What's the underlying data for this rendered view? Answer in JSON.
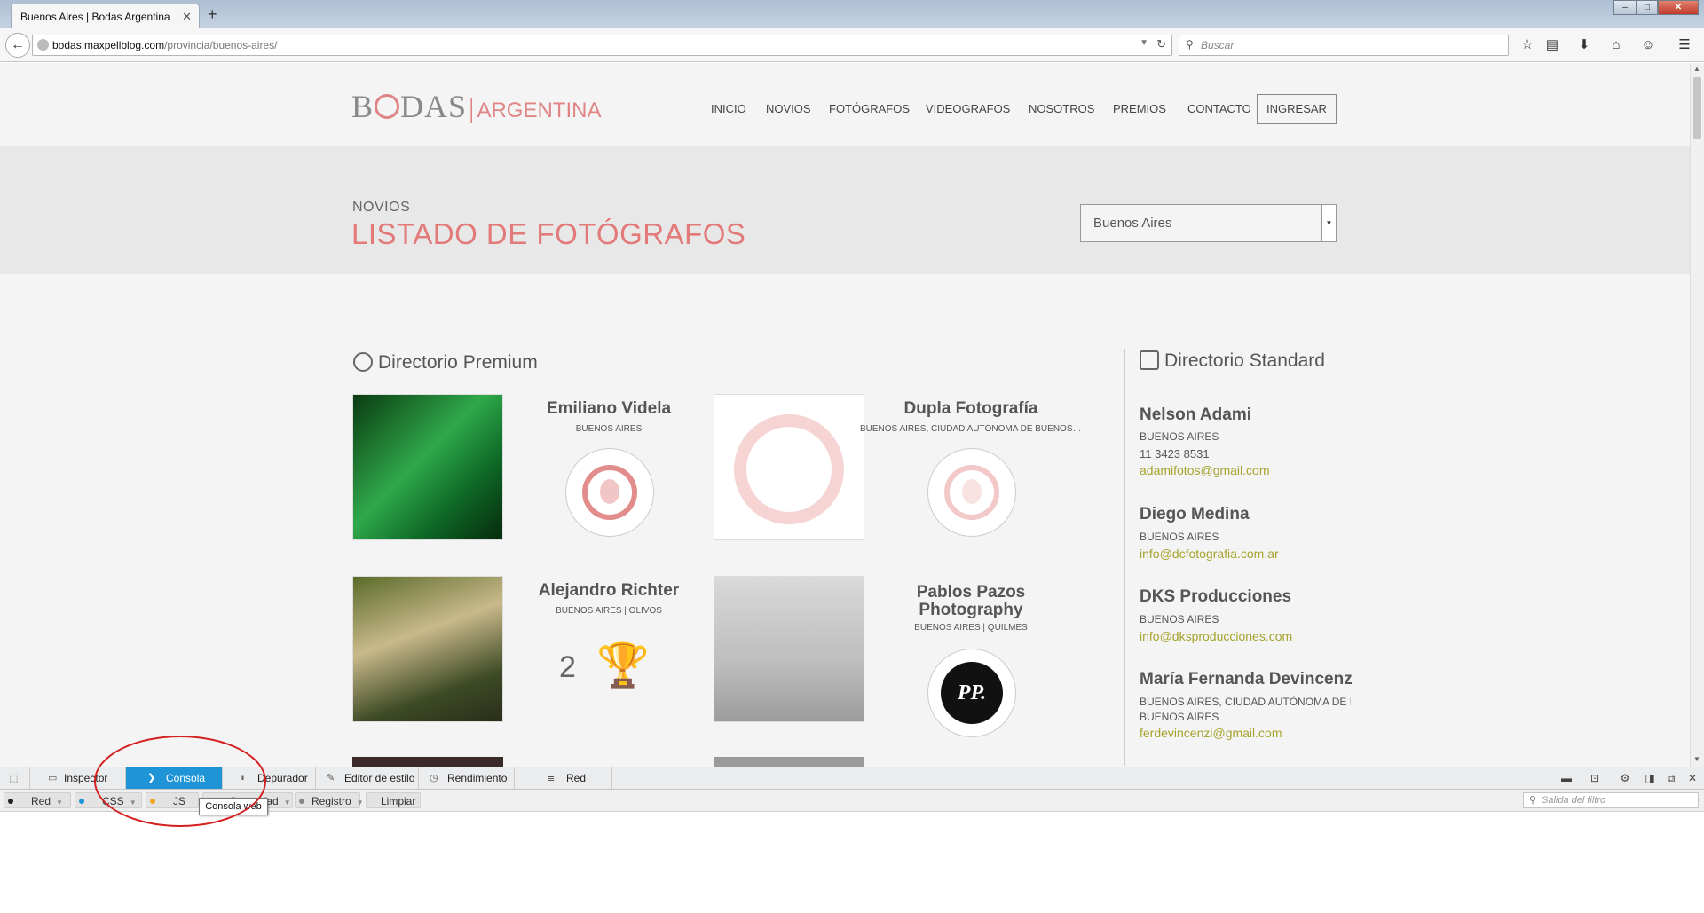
{
  "browser": {
    "tab_title": "Buenos Aires | Bodas Argentina",
    "url_host": "bodas.maxpellblog.com",
    "url_path": "/provincia/buenos-aires/",
    "search_placeholder": "Buscar"
  },
  "site": {
    "logo_main": "B",
    "logo_rest": "DAS",
    "logo_sub": "ARGENTINA",
    "menu": [
      "INICIO",
      "NOVIOS",
      "FOTÓGRAFOS",
      "VIDEOGRAFOS",
      "NOSOTROS",
      "PREMIOS",
      "CONTACTO"
    ],
    "login": "INGRESAR"
  },
  "hero": {
    "subtitle": "NOVIOS",
    "title": "LISTADO DE FOTÓGRAFOS",
    "province_selected": "Buenos Aires"
  },
  "premium": {
    "heading": "Directorio Premium",
    "items": [
      {
        "name": "Emiliano Videla",
        "location": "BUENOS AIRES"
      },
      {
        "name": "Dupla Fotografía",
        "location": "BUENOS AIRES, CIUDAD AUTÓNOMA DE BUENOS AIRES"
      },
      {
        "name": "Alejandro Richter",
        "location": "BUENOS AIRES | OLIVOS",
        "awards": "2"
      },
      {
        "name_line1": "Pablos Pazos",
        "name_line2": "Photography",
        "location": "BUENOS AIRES | QUILMES",
        "logo_text": "PP."
      }
    ]
  },
  "standard": {
    "heading": "Directorio Standard",
    "items": [
      {
        "name": "Nelson Adami",
        "location": "BUENOS AIRES",
        "phone": "11 3423 8531",
        "email": "adamifotos@gmail.com"
      },
      {
        "name": "Diego Medina",
        "location": "BUENOS AIRES",
        "email": "info@dcfotografia.com.ar"
      },
      {
        "name": "DKS Producciones",
        "location": "BUENOS AIRES",
        "email": "info@dksproducciones.com"
      },
      {
        "name": "María Fernanda Devincenzi",
        "location": "BUENOS AIRES, CIUDAD AUTÓNOMA DE BUENOS AIRES",
        "location2": "BUENOS AIRES",
        "email": "ferdevincenzi@gmail.com"
      }
    ]
  },
  "devtools": {
    "tabs": [
      "Inspector",
      "Consola",
      "Depurador",
      "Editor de estilo",
      "Rendimiento",
      "Red"
    ],
    "filters": [
      "Red",
      "CSS",
      "JS",
      "Seguridad",
      "Registro"
    ],
    "clear": "Limpiar",
    "filter_placeholder": "Salida del filtro",
    "tooltip": "Consola web"
  },
  "colors": {
    "brand": "#e27a7a",
    "email": "#a6a32e",
    "devtools_active": "#1f95d8",
    "annotation": "#d42020"
  }
}
